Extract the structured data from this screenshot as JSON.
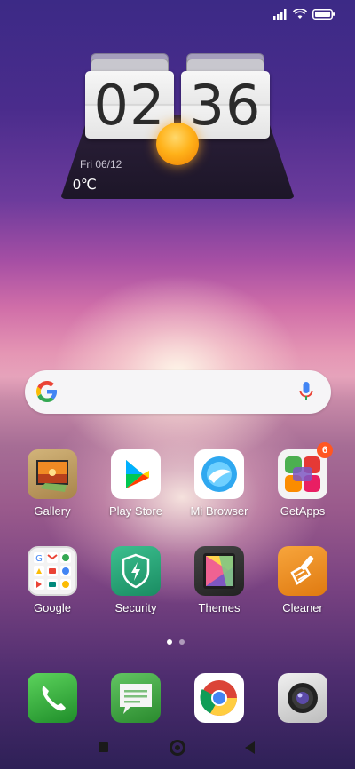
{
  "status_bar": {
    "icons": [
      "signal-icon",
      "wifi-icon",
      "battery-icon"
    ]
  },
  "clock_widget": {
    "hour": "02",
    "minute": "36",
    "date": "Fri  06/12",
    "temperature": "0℃",
    "weather_icon": "sun-icon"
  },
  "search_bar": {
    "icons": [
      "google-g-icon",
      "microphone-icon"
    ]
  },
  "apps_row1": [
    {
      "label": "Gallery",
      "icon": "gallery-icon"
    },
    {
      "label": "Play Store",
      "icon": "play-store-icon"
    },
    {
      "label": "Mi Browser",
      "icon": "mi-browser-icon"
    },
    {
      "label": "GetApps",
      "icon": "getapps-icon",
      "badge": "6"
    }
  ],
  "apps_row2": [
    {
      "label": "Google",
      "icon": "google-folder-icon"
    },
    {
      "label": "Security",
      "icon": "security-icon"
    },
    {
      "label": "Themes",
      "icon": "themes-icon"
    },
    {
      "label": "Cleaner",
      "icon": "cleaner-icon"
    }
  ],
  "page_indicator": {
    "pages": 2,
    "active": 1
  },
  "dock": [
    {
      "icon": "phone-icon"
    },
    {
      "icon": "messages-icon"
    },
    {
      "icon": "chrome-icon"
    },
    {
      "icon": "camera-icon"
    }
  ],
  "nav_bar": {
    "buttons": [
      "recents-button",
      "home-button",
      "back-button"
    ]
  },
  "colors": {
    "badge": "#ff5722",
    "search_bg": "#f6f5f7"
  }
}
